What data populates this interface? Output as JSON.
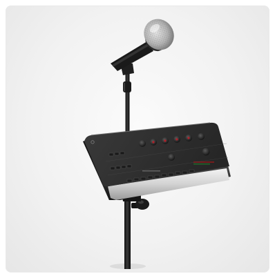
{
  "image": {
    "alt": "",
    "colors": {
      "background": "#f2f2f2",
      "stand": "#1b1b1b",
      "mixer_body": "#2a2a2a",
      "mixer_trim": "#d9d9d9",
      "knob": "#2b2b2b",
      "knob_accent": "#b0202a"
    }
  }
}
